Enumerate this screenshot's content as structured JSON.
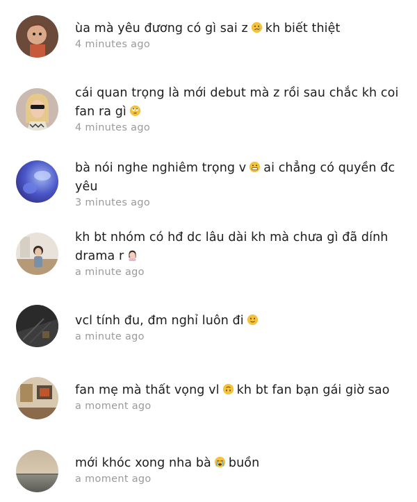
{
  "comments": [
    {
      "text_before": "ùa mà yêu đương có gì sai z",
      "emoji": "sad-face-emoji",
      "text_after": "kh biết thiệt",
      "time": "4 minutes ago"
    },
    {
      "text_before": "cái quan trọng là mới debut mà z rồi sau chắc kh coi fan ra gì",
      "emoji": "eye-roll-emoji",
      "text_after": "",
      "time": "4 minutes ago"
    },
    {
      "text_before": "bà nói nghe nghiêm trọng v",
      "emoji": "grimace-emoji",
      "text_after": "ai chẳng có quyền đc yêu",
      "time": "3 minutes ago"
    },
    {
      "text_before": "kh bt nhóm có hđ dc lâu dài kh mà chưa gì đã dính drama r",
      "emoji": "facepalm-woman-emoji",
      "text_after": "",
      "time": "a minute ago"
    },
    {
      "text_before": "vcl tính đu, đm nghỉ luôn đi",
      "emoji": "slight-smile-emoji",
      "text_after": "",
      "time": "a minute ago"
    },
    {
      "text_before": "fan mẹ mà thất vọng vl",
      "emoji": "upside-down-face-emoji",
      "text_after": "kh bt fan bạn gái giờ sao",
      "time": "a moment ago"
    },
    {
      "text_before": "mới khóc xong nha bà",
      "emoji": "crying-face-emoji",
      "text_after": "buồn",
      "time": "a moment ago"
    }
  ]
}
